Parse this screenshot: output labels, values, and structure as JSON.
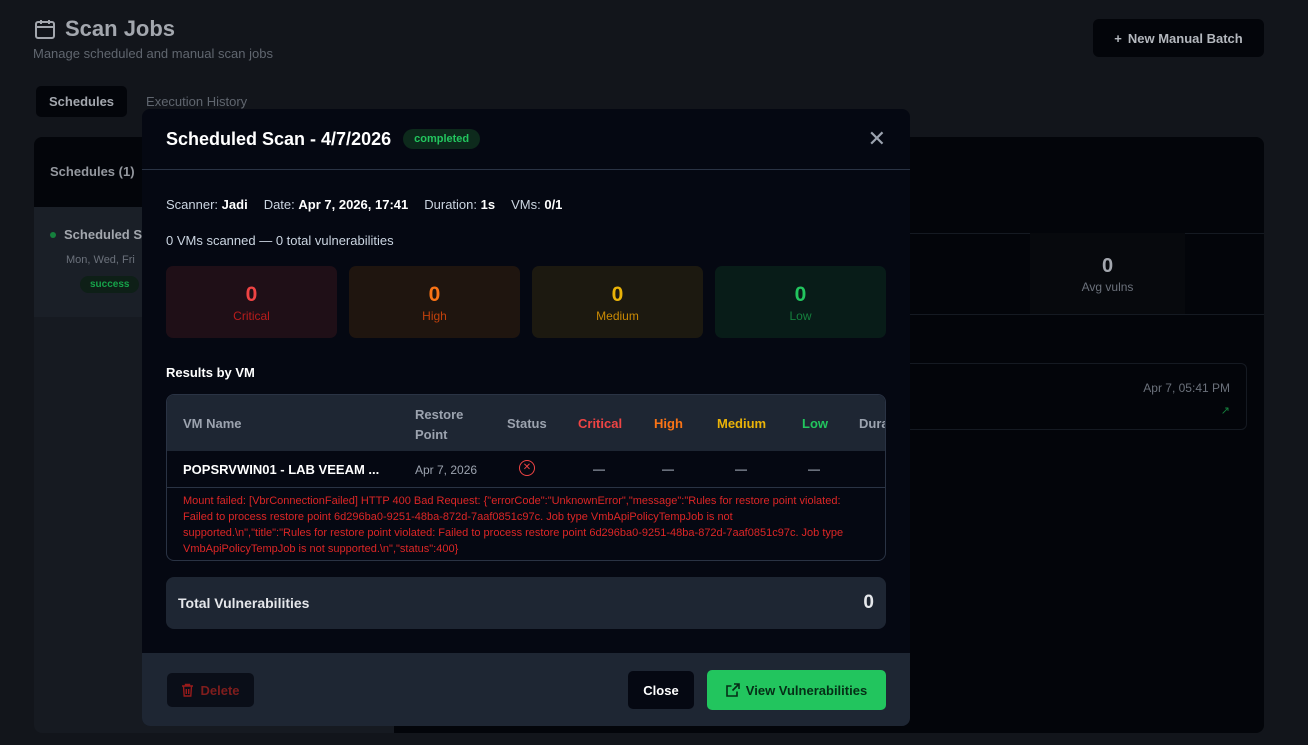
{
  "page": {
    "title": "Scan Jobs",
    "subtitle": "Manage scheduled and manual scan jobs",
    "new_batch": "New Manual Batch",
    "tabs": [
      {
        "label": "Schedules"
      },
      {
        "label": "Execution History"
      }
    ],
    "schedules_header": "Schedules (1)",
    "schedule_item": {
      "name": "Scheduled Scan",
      "days": "Mon, Wed, Fri",
      "status": "success"
    },
    "avg_value": "0",
    "avg_label": "Avg vulns",
    "run_date": "Apr 7, 05:41 PM"
  },
  "modal": {
    "title": "Scheduled Scan - 4/7/2026",
    "status": "completed",
    "meta": {
      "scanner_label": "Scanner:",
      "scanner": "Jadi",
      "date_label": "Date:",
      "date": "Apr 7, 2026, 17:41",
      "duration_label": "Duration:",
      "duration": "1s",
      "vms_label": "VMs:",
      "vms": "0/1"
    },
    "summary": "0 VMs scanned — 0 total vulnerabilities",
    "cards": [
      {
        "value": "0",
        "label": "Critical"
      },
      {
        "value": "0",
        "label": "High"
      },
      {
        "value": "0",
        "label": "Medium"
      },
      {
        "value": "0",
        "label": "Low"
      }
    ],
    "results_title": "Results by VM",
    "columns": [
      "VM Name",
      "Restore Point",
      "Status",
      "Critical",
      "High",
      "Medium",
      "Low",
      "Duration"
    ],
    "row": {
      "vm": "POPSRVWIN01 - LAB VEEAM ...",
      "restore_point": "Apr 7, 2026",
      "critical": "—",
      "high": "—",
      "medium": "—",
      "low": "—"
    },
    "error_lines": [
      "Mount failed: [VbrConnectionFailed] HTTP 400 Bad Request: {\"errorCode\":\"UnknownError\",\"message\":\"Rules for restore point violated:",
      "Failed to process restore point 6d296ba0-9251-48ba-872d-7aaf0851c97c. Job type VmbApiPolicyTempJob is not",
      "supported.\\n\",\"title\":\"Rules for restore point violated: Failed to process restore point 6d296ba0-9251-48ba-872d-7aaf0851c97c. Job type",
      "VmbApiPolicyTempJob is not supported.\\n\",\"status\":400}"
    ],
    "total_label": "Total Vulnerabilities",
    "total_value": "0",
    "delete": "Delete",
    "close": "Close",
    "view": "View Vulnerabilities"
  },
  "colors": {
    "critical": "#ef4444",
    "high": "#f97316",
    "medium": "#eab308",
    "low": "#22c55e"
  }
}
